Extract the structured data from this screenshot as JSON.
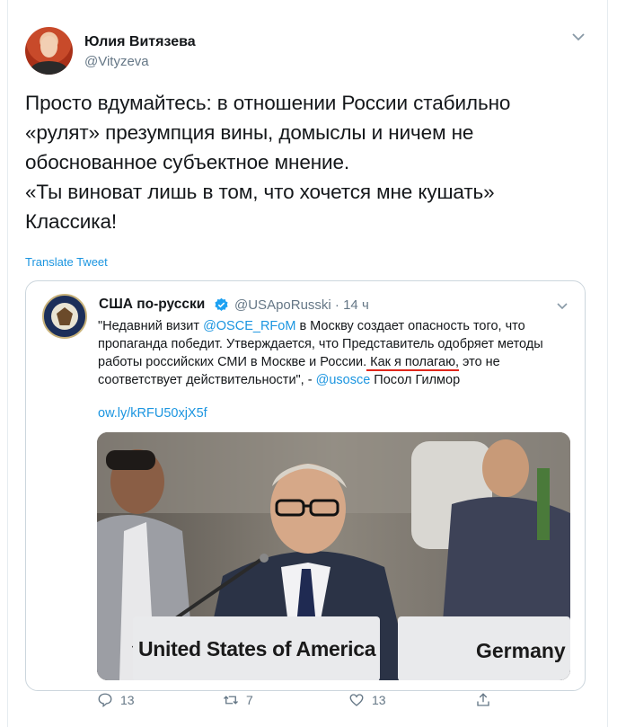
{
  "tweet": {
    "author_name": "Юлия Витязева",
    "author_handle": "@Vityzeva",
    "text": "Просто вдумайтесь: в отношении России стабильно\n«рулят» презумпция вины, домыслы и ничем не\nобоснованное субъектное мнение.\n«Ты виноват лишь в том, что хочется мне кушать»\nКлассика!",
    "translate_label": "Translate Tweet"
  },
  "quoted": {
    "author_name": "США по-русски",
    "author_handle": "@USApoRusski · 14 ч",
    "text_1": "\"Недавний визит ",
    "mention_1": "@OSCE_RFoM",
    "text_2": " в Москву создает опасность того, что пропаганда победит. Утверждается, что Представитель одобряет методы работы российских СМИ в Москве и России.",
    "underlined": " Как я полагаю,",
    "text_3": " это не соответствует действительности\", - ",
    "mention_2": "@usosce",
    "text_4": " Посол Гилмор",
    "link": "ow.ly/kRFU50xjX5f",
    "photo": {
      "placard_left": "United States of America",
      "placard_right": "Germany"
    }
  },
  "actions": {
    "replies": "13",
    "retweets": "7",
    "likes": "13"
  },
  "colors": {
    "link_blue": "#1b95e0",
    "secondary_text": "#657786",
    "underline_red": "#e0261b",
    "border": "#ccd6dd"
  }
}
